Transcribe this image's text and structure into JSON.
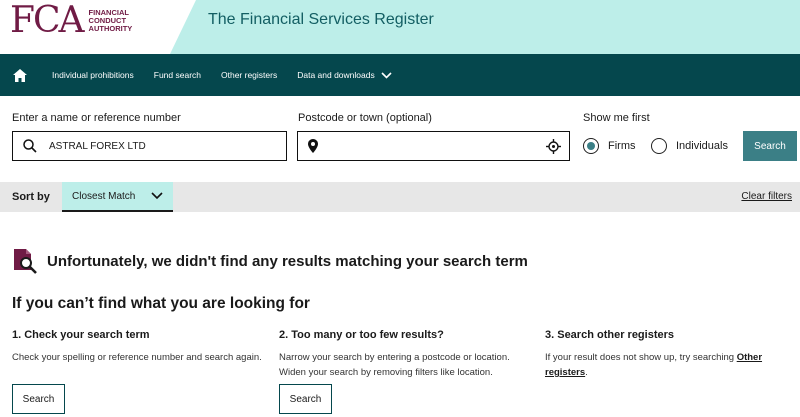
{
  "header": {
    "logo_letters": "FCA",
    "logo_sub": "FINANCIAL CONDUCT AUTHORITY",
    "title": "The Financial Services Register"
  },
  "nav": {
    "items": [
      "Individual prohibitions",
      "Fund search",
      "Other registers",
      "Data and downloads"
    ]
  },
  "search": {
    "name_label": "Enter a name or reference number",
    "name_value": "ASTRAL FOREX LTD",
    "postcode_label": "Postcode or town (optional)",
    "postcode_value": "",
    "show_label": "Show me first",
    "option_firms": "Firms",
    "option_individuals": "Individuals",
    "selected": "Firms",
    "button": "Search"
  },
  "sort": {
    "label": "Sort by",
    "selected": "Closest Match",
    "clear": "Clear filters"
  },
  "results": {
    "no_results": "Unfortunately, we didn't find any results matching your search term",
    "help_title": "If you can’t find what you are looking for",
    "columns": [
      {
        "heading": "1. Check your search term",
        "text": "Check your spelling or reference number and search again.",
        "button": "Search"
      },
      {
        "heading": "2. Too many or too few results?",
        "text": "Narrow your search by entering a postcode or location. Widen your search by removing filters like location.",
        "button": "Search"
      },
      {
        "heading": "3. Search other registers",
        "text_before": "If your result does not show up, try searching ",
        "link": "Other registers",
        "text_after": "."
      }
    ]
  },
  "colors": {
    "brand": "#701b45",
    "nav_bg": "#05474d",
    "accent": "#3b7f86",
    "teal_light": "#bdeee9"
  }
}
